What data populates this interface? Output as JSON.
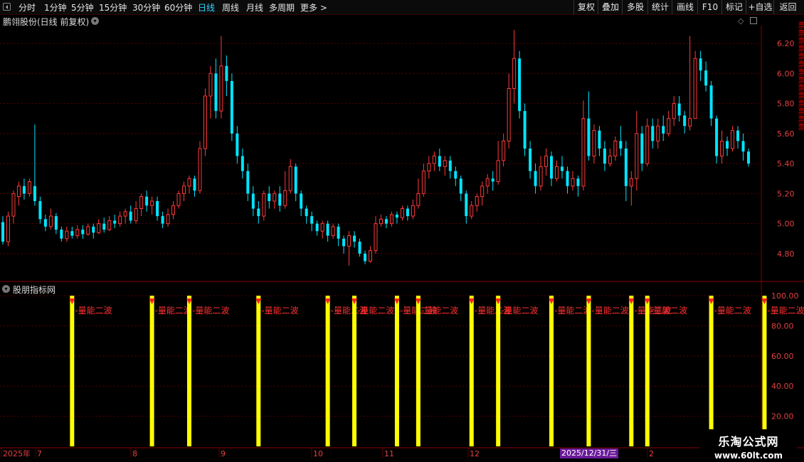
{
  "toolbar": {
    "periods": [
      "分时",
      "1分钟",
      "5分钟",
      "15分钟",
      "30分钟",
      "60分钟",
      "日线",
      "周线",
      "月线",
      "多周期",
      "更多 >"
    ],
    "active_period": "日线",
    "right_buttons": [
      "复权",
      "叠加",
      "多股",
      "统计",
      "画线",
      "F10",
      "标记",
      "+自选",
      "返回"
    ]
  },
  "main_panel": {
    "title": "鹏翎股份(日线 前复权)",
    "y_ticks": [
      "6.20",
      "6.00",
      "5.80",
      "5.60",
      "5.40",
      "5.20",
      "5.00",
      "4.80"
    ]
  },
  "indicator_panel": {
    "title": "股朋指标网",
    "y_ticks": [
      "100.00",
      "80.00",
      "60.00",
      "40.00",
      "20.00"
    ],
    "signal_label": "量能二波"
  },
  "date_axis": {
    "labels": [
      "2025年",
      "7",
      "8",
      "9",
      "10",
      "11",
      "12",
      "2"
    ],
    "selected_date": "2025/12/31/三"
  },
  "watermark": {
    "line1": "乐淘公式网",
    "line2": "www.60lt.com"
  },
  "colors": {
    "up": "#ff3a3a",
    "down": "#00e5ff",
    "signal_bar": "#ffff00",
    "grid": "#5a0000",
    "axis_text": "#e04040"
  },
  "chart_data": {
    "type": "candlestick",
    "title": "鹏翎股份(日线 前复权)",
    "price_ylim": [
      4.7,
      6.3
    ],
    "candles": [
      [
        5.01,
        4.88,
        5.05,
        4.86
      ],
      [
        4.88,
        5.05,
        5.08,
        4.85
      ],
      [
        5.05,
        5.2,
        5.22,
        5.0
      ],
      [
        5.18,
        5.25,
        5.28,
        5.12
      ],
      [
        5.25,
        5.2,
        5.3,
        5.16
      ],
      [
        5.2,
        5.28,
        5.3,
        5.18
      ],
      [
        5.25,
        5.15,
        5.66,
        5.12
      ],
      [
        5.15,
        5.03,
        5.18,
        5.0
      ],
      [
        5.03,
        4.98,
        5.06,
        4.95
      ],
      [
        4.98,
        5.05,
        5.1,
        4.96
      ],
      [
        5.05,
        4.96,
        5.07,
        4.93
      ],
      [
        4.96,
        4.9,
        4.98,
        4.88
      ],
      [
        4.9,
        4.95,
        4.98,
        4.88
      ],
      [
        4.95,
        4.92,
        4.98,
        4.9
      ],
      [
        4.92,
        4.96,
        4.99,
        4.9
      ],
      [
        4.96,
        4.93,
        4.99,
        4.9
      ],
      [
        4.93,
        4.98,
        5.0,
        4.92
      ],
      [
        4.98,
        4.94,
        5.0,
        4.9
      ],
      [
        4.94,
        5.0,
        5.03,
        4.93
      ],
      [
        5.0,
        4.96,
        5.04,
        4.94
      ],
      [
        4.96,
        5.02,
        5.05,
        4.95
      ],
      [
        5.02,
        5.0,
        5.06,
        4.97
      ],
      [
        5.0,
        5.05,
        5.08,
        4.98
      ],
      [
        5.05,
        5.08,
        5.1,
        5.0
      ],
      [
        5.08,
        5.02,
        5.12,
        5.0
      ],
      [
        5.02,
        5.1,
        5.15,
        5.0
      ],
      [
        5.1,
        5.18,
        5.2,
        5.05
      ],
      [
        5.18,
        5.12,
        5.22,
        5.08
      ],
      [
        5.12,
        5.15,
        5.18,
        5.06
      ],
      [
        5.15,
        5.05,
        5.18,
        5.02
      ],
      [
        5.05,
        5.0,
        5.08,
        4.97
      ],
      [
        5.0,
        5.06,
        5.1,
        4.98
      ],
      [
        5.06,
        5.12,
        5.15,
        5.03
      ],
      [
        5.12,
        5.2,
        5.22,
        5.1
      ],
      [
        5.2,
        5.25,
        5.28,
        5.15
      ],
      [
        5.25,
        5.3,
        5.32,
        5.2
      ],
      [
        5.3,
        5.22,
        5.32,
        5.18
      ],
      [
        5.22,
        5.5,
        5.55,
        5.2
      ],
      [
        5.5,
        5.85,
        5.9,
        5.45
      ],
      [
        5.85,
        6.0,
        6.05,
        5.7
      ],
      [
        6.0,
        5.75,
        6.1,
        5.7
      ],
      [
        5.75,
        6.05,
        6.25,
        5.7
      ],
      [
        6.05,
        5.95,
        6.12,
        5.85
      ],
      [
        5.95,
        5.6,
        6.0,
        5.55
      ],
      [
        5.6,
        5.45,
        5.65,
        5.4
      ],
      [
        5.45,
        5.35,
        5.5,
        5.3
      ],
      [
        5.35,
        5.2,
        5.4,
        5.15
      ],
      [
        5.2,
        5.1,
        5.25,
        5.05
      ],
      [
        5.1,
        5.05,
        5.15,
        5.0
      ],
      [
        5.05,
        5.2,
        5.22,
        5.02
      ],
      [
        5.2,
        5.15,
        5.25,
        5.1
      ],
      [
        5.15,
        5.2,
        5.22,
        5.1
      ],
      [
        5.2,
        5.12,
        5.25,
        5.08
      ],
      [
        5.12,
        5.22,
        5.35,
        5.1
      ],
      [
        5.22,
        5.38,
        5.43,
        5.2
      ],
      [
        5.38,
        5.2,
        5.4,
        5.15
      ],
      [
        5.2,
        5.1,
        5.22,
        5.05
      ],
      [
        5.1,
        5.05,
        5.12,
        5.0
      ],
      [
        5.05,
        5.0,
        5.08,
        4.95
      ],
      [
        5.0,
        4.95,
        5.02,
        4.92
      ],
      [
        4.95,
        5.0,
        5.02,
        4.9
      ],
      [
        5.0,
        4.92,
        5.02,
        4.88
      ],
      [
        4.92,
        4.98,
        5.0,
        4.9
      ],
      [
        4.98,
        4.9,
        5.0,
        4.85
      ],
      [
        4.9,
        4.85,
        4.92,
        4.8
      ],
      [
        4.85,
        4.92,
        4.95,
        4.72
      ],
      [
        4.92,
        4.88,
        4.95,
        4.84
      ],
      [
        4.88,
        4.8,
        4.9,
        4.78
      ],
      [
        4.8,
        4.75,
        4.82,
        4.73
      ],
      [
        4.75,
        4.82,
        4.85,
        4.74
      ],
      [
        4.82,
        5.0,
        5.05,
        4.8
      ],
      [
        5.0,
        5.03,
        5.06,
        4.98
      ],
      [
        5.03,
        5.0,
        5.05,
        4.97
      ],
      [
        5.0,
        5.06,
        5.08,
        4.98
      ],
      [
        5.06,
        5.04,
        5.08,
        5.0
      ],
      [
        5.04,
        5.1,
        5.12,
        5.02
      ],
      [
        5.1,
        5.05,
        5.12,
        5.02
      ],
      [
        5.05,
        5.12,
        5.16,
        5.03
      ],
      [
        5.12,
        5.2,
        5.3,
        5.1
      ],
      [
        5.2,
        5.35,
        5.4,
        5.18
      ],
      [
        5.35,
        5.4,
        5.45,
        5.3
      ],
      [
        5.4,
        5.45,
        5.48,
        5.35
      ],
      [
        5.45,
        5.38,
        5.5,
        5.35
      ],
      [
        5.38,
        5.42,
        5.45,
        5.32
      ],
      [
        5.42,
        5.35,
        5.45,
        5.3
      ],
      [
        5.35,
        5.3,
        5.38,
        5.25
      ],
      [
        5.3,
        5.2,
        5.32,
        5.15
      ],
      [
        5.2,
        5.05,
        5.22,
        5.0
      ],
      [
        5.05,
        5.12,
        5.15,
        5.03
      ],
      [
        5.12,
        5.18,
        5.2,
        5.08
      ],
      [
        5.18,
        5.25,
        5.28,
        5.12
      ],
      [
        5.25,
        5.3,
        5.33,
        5.2
      ],
      [
        5.3,
        5.28,
        5.35,
        5.22
      ],
      [
        5.28,
        5.42,
        5.55,
        5.26
      ],
      [
        5.42,
        5.55,
        5.6,
        5.38
      ],
      [
        5.55,
        5.9,
        6.0,
        5.5
      ],
      [
        5.9,
        6.1,
        6.29,
        5.8
      ],
      [
        6.1,
        5.75,
        6.15,
        5.7
      ],
      [
        5.75,
        5.5,
        5.8,
        5.45
      ],
      [
        5.5,
        5.35,
        5.55,
        5.3
      ],
      [
        5.35,
        5.25,
        5.4,
        5.2
      ],
      [
        5.25,
        5.38,
        5.45,
        5.22
      ],
      [
        5.38,
        5.45,
        5.5,
        5.32
      ],
      [
        5.45,
        5.3,
        5.48,
        5.25
      ],
      [
        5.3,
        5.38,
        5.42,
        5.28
      ],
      [
        5.38,
        5.35,
        5.45,
        5.3
      ],
      [
        5.35,
        5.25,
        5.38,
        5.2
      ],
      [
        5.25,
        5.3,
        5.35,
        5.22
      ],
      [
        5.3,
        5.25,
        5.32,
        5.18
      ],
      [
        5.25,
        5.7,
        5.82,
        5.22
      ],
      [
        5.7,
        5.45,
        5.88,
        5.42
      ],
      [
        5.45,
        5.62,
        5.66,
        5.4
      ],
      [
        5.62,
        5.5,
        5.65,
        5.45
      ],
      [
        5.5,
        5.4,
        5.55,
        5.35
      ],
      [
        5.4,
        5.45,
        5.5,
        5.38
      ],
      [
        5.45,
        5.55,
        5.58,
        5.42
      ],
      [
        5.55,
        5.5,
        5.65,
        5.45
      ],
      [
        5.5,
        5.25,
        5.55,
        5.15
      ],
      [
        5.25,
        5.3,
        5.35,
        5.12
      ],
      [
        5.3,
        5.6,
        5.75,
        5.22
      ],
      [
        5.6,
        5.4,
        5.65,
        5.35
      ],
      [
        5.4,
        5.65,
        5.7,
        5.38
      ],
      [
        5.65,
        5.55,
        5.7,
        5.5
      ],
      [
        5.55,
        5.65,
        5.7,
        5.5
      ],
      [
        5.65,
        5.6,
        5.72,
        5.55
      ],
      [
        5.6,
        5.7,
        5.75,
        5.58
      ],
      [
        5.7,
        5.8,
        5.85,
        5.65
      ],
      [
        5.8,
        5.72,
        5.85,
        5.68
      ],
      [
        5.72,
        5.65,
        5.75,
        5.6
      ],
      [
        5.65,
        5.7,
        6.25,
        5.62
      ],
      [
        5.7,
        6.1,
        6.15,
        5.9
      ],
      [
        6.1,
        6.02,
        6.15,
        5.95
      ],
      [
        6.02,
        5.92,
        6.08,
        5.88
      ],
      [
        5.92,
        5.7,
        5.95,
        5.65
      ],
      [
        5.7,
        5.45,
        5.72,
        5.4
      ],
      [
        5.45,
        5.55,
        5.62,
        5.4
      ],
      [
        5.55,
        5.5,
        5.58,
        5.45
      ],
      [
        5.5,
        5.62,
        5.65,
        5.48
      ],
      [
        5.62,
        5.55,
        5.65,
        5.5
      ],
      [
        5.55,
        5.48,
        5.6,
        5.42
      ],
      [
        5.48,
        5.4,
        5.5,
        5.38
      ]
    ]
  }
}
